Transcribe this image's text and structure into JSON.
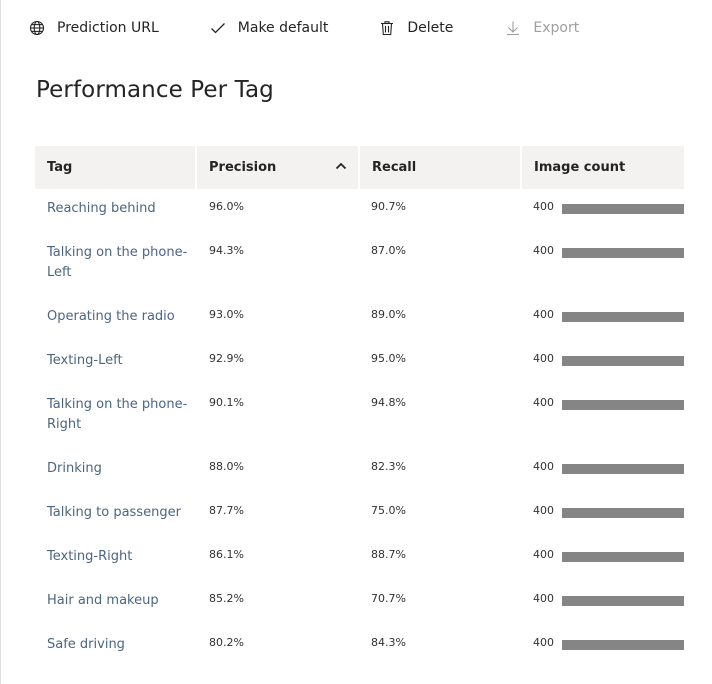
{
  "toolbar": {
    "prediction_url": "Prediction URL",
    "make_default": "Make default",
    "delete": "Delete",
    "export": "Export"
  },
  "title": "Performance Per Tag",
  "table": {
    "headers": {
      "tag": "Tag",
      "precision": "Precision",
      "recall": "Recall",
      "image_count": "Image count"
    },
    "sort": {
      "column": "precision",
      "direction": "ascending-indicator"
    },
    "rows": [
      {
        "tag_line1": "Reaching behind",
        "tag_line2": "",
        "precision": "96.0%",
        "recall": "90.7%",
        "image_count": "400",
        "count_fraction": 1.0
      },
      {
        "tag_line1": "Talking on the phone-",
        "tag_line2": "Left",
        "precision": "94.3%",
        "recall": "87.0%",
        "image_count": "400",
        "count_fraction": 1.0
      },
      {
        "tag_line1": "Operating the radio",
        "tag_line2": "",
        "precision": "93.0%",
        "recall": "89.0%",
        "image_count": "400",
        "count_fraction": 1.0
      },
      {
        "tag_line1": "Texting-Left",
        "tag_line2": "",
        "precision": "92.9%",
        "recall": "95.0%",
        "image_count": "400",
        "count_fraction": 1.0
      },
      {
        "tag_line1": "Talking on the phone-",
        "tag_line2": "Right",
        "precision": "90.1%",
        "recall": "94.8%",
        "image_count": "400",
        "count_fraction": 1.0
      },
      {
        "tag_line1": "Drinking",
        "tag_line2": "",
        "precision": "88.0%",
        "recall": "82.3%",
        "image_count": "400",
        "count_fraction": 1.0
      },
      {
        "tag_line1": "Talking to passenger",
        "tag_line2": "",
        "precision": "87.7%",
        "recall": "75.0%",
        "image_count": "400",
        "count_fraction": 1.0
      },
      {
        "tag_line1": "Texting-Right",
        "tag_line2": "",
        "precision": "86.1%",
        "recall": "88.7%",
        "image_count": "400",
        "count_fraction": 1.0
      },
      {
        "tag_line1": "Hair and makeup",
        "tag_line2": "",
        "precision": "85.2%",
        "recall": "70.7%",
        "image_count": "400",
        "count_fraction": 1.0
      },
      {
        "tag_line1": "Safe driving",
        "tag_line2": "",
        "precision": "80.2%",
        "recall": "84.3%",
        "image_count": "400",
        "count_fraction": 1.0
      }
    ]
  },
  "colors": {
    "bar": "#858585",
    "header_bg": "#f3f2f1",
    "tag_text": "#4c6580",
    "disabled": "#a19f9d"
  },
  "icons": {
    "prediction_url": "globe-icon",
    "make_default": "checkmark-icon",
    "delete": "trash-icon",
    "export": "download-arrow-icon",
    "sort": "chevron-up-icon"
  }
}
